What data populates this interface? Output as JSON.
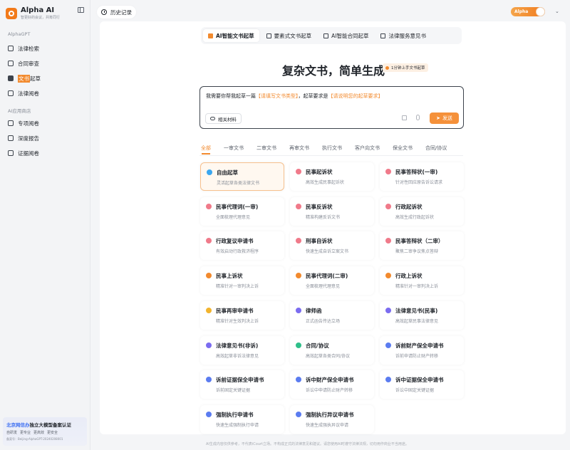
{
  "sidebar": {
    "app_name": "Alpha AI",
    "slogan": "智更好的会议，共筹同行",
    "sections": [
      {
        "label": "AlphaGPT"
      },
      {
        "label": "AI应用商店"
      }
    ],
    "items": [
      {
        "label": "法律检索",
        "icon": "search-doc-icon"
      },
      {
        "label": "合同审查",
        "icon": "contract-icon"
      },
      {
        "label_hl": "文书",
        "label_rest": "起草",
        "icon": "document-icon",
        "active": true
      },
      {
        "label": "法律阅卷",
        "icon": "checkbox-icon"
      },
      {
        "label": "专项阅卷",
        "icon": "folder-icon"
      },
      {
        "label": "深度报告",
        "icon": "report-icon"
      },
      {
        "label": "证据阅卷",
        "icon": "evidence-icon"
      }
    ],
    "promo": {
      "title_blue": "北京网信办",
      "title_rest": "独立大模型备案认证",
      "tags": [
        "自研发",
        "更专业",
        "更高效",
        "更安全"
      ],
      "registration": "备案号：Beijing-AlphaGPT-20240208001"
    }
  },
  "header": {
    "history_label": "历史记录",
    "alpha_badge": "Alpha",
    "user_chevron": "⌄"
  },
  "tabs": [
    {
      "label": "AI智能文书起草",
      "active": true
    },
    {
      "label": "要素式文书起草"
    },
    {
      "label": "AI智能合同起草"
    },
    {
      "label": "法律服务意见书"
    }
  ],
  "hero": {
    "title": "复杂文书，简单生成",
    "badge": "1分钟上手文书起草"
  },
  "prompt": {
    "prefix": "我需要你帮我起草一篇",
    "placeholder1": "【请填写文书类型】",
    "middle": "，起草要求是",
    "placeholder2": "【请说明您的起草要求】",
    "attach_label": "相关材料",
    "send_label": "发送"
  },
  "filters": [
    "全部",
    "一审文书",
    "二审文书",
    "再审文书",
    "执行文书",
    "客户向文书",
    "保全文书",
    "合同/协议"
  ],
  "cards": [
    {
      "title": "自由起草",
      "desc": "灵活起草各类法律文书",
      "color": "#3aa7f0",
      "active": true
    },
    {
      "title": "民事起诉状",
      "desc": "高效生成民事起诉状",
      "color": "#f07a8a"
    },
    {
      "title": "民事答辩状(一审)",
      "desc": "针对性回应原告诉讼请求",
      "color": "#f07a8a"
    },
    {
      "title": "民事代理词(一审)",
      "desc": "全面梳理代理意见",
      "color": "#f07a8a"
    },
    {
      "title": "民事反诉状",
      "desc": "精准构建反诉文书",
      "color": "#f07a8a"
    },
    {
      "title": "行政起诉状",
      "desc": "高效生成行政起诉状",
      "color": "#f07a8a"
    },
    {
      "title": "行政复议申请书",
      "desc": "有效启动行政救济程序",
      "color": "#f07a8a"
    },
    {
      "title": "刑事自诉状",
      "desc": "快速生成自诉立案文书",
      "color": "#f07a8a"
    },
    {
      "title": "民事答辩状（二审）",
      "desc": "聚焦二审争议焦点答辩",
      "color": "#f07a8a"
    },
    {
      "title": "民事上诉状",
      "desc": "精准针对一审判决上诉",
      "color": "#f28a2e"
    },
    {
      "title": "民事代理词(二审)",
      "desc": "全面梳理代理意见",
      "color": "#f28a2e"
    },
    {
      "title": "行政上诉状",
      "desc": "精准针对一审判决上诉",
      "color": "#f28a2e"
    },
    {
      "title": "民事再审申请书",
      "desc": "精准针对生效判决上诉",
      "color": "#f2b42e"
    },
    {
      "title": "律师函",
      "desc": "正式函告传达立场",
      "color": "#7b6cf0"
    },
    {
      "title": "法律意见书(民事)",
      "desc": "高效起草民事法律意见",
      "color": "#7b6cf0"
    },
    {
      "title": "法律意见书(非诉)",
      "desc": "高效起草非诉法律意见",
      "color": "#7b6cf0"
    },
    {
      "title": "合同/协议",
      "desc": "高效起草各类合同/协议",
      "color": "#2fbf8a"
    },
    {
      "title": "诉前财产保全申请书",
      "desc": "诉前申请防止财产转移",
      "color": "#5b7cf0"
    },
    {
      "title": "诉前证据保全申请书",
      "desc": "诉前固定关键证据",
      "color": "#5b7cf0"
    },
    {
      "title": "诉中财产保全申请书",
      "desc": "诉讼中申请防止财产转移",
      "color": "#5b7cf0"
    },
    {
      "title": "诉中证据保全申请书",
      "desc": "诉讼中固定关键证据",
      "color": "#5b7cf0"
    },
    {
      "title": "强制执行申请书",
      "desc": "快速生成强制执行申请",
      "color": "#5b7cf0"
    },
    {
      "title": "强制执行异议申请书",
      "desc": "快速生成强执异议申请",
      "color": "#5b7cf0"
    }
  ],
  "footer": "AI生成内容仅供参考，不代表iCourt立场。不构成正式的法律意见和建议。请您使用AI时遵守法律法规，切勿用作商业不当用途。"
}
